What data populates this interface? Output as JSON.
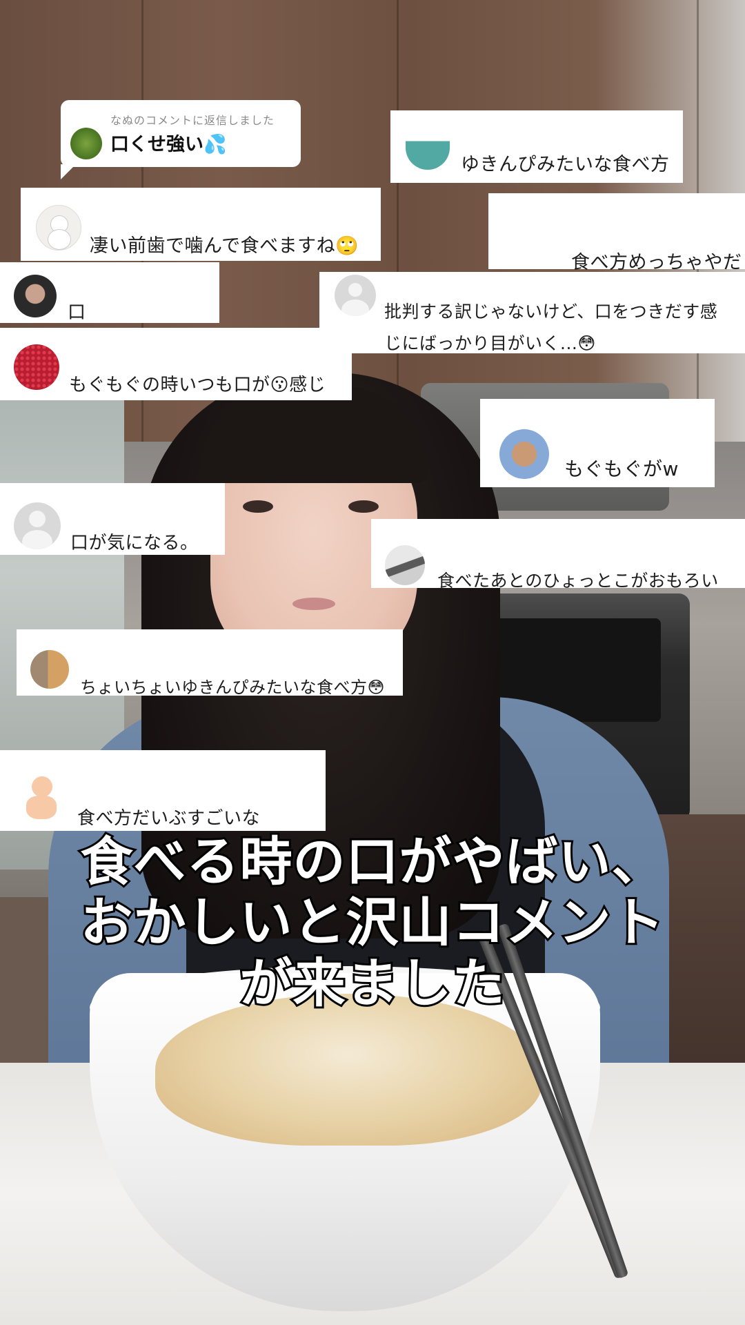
{
  "reply_header": {
    "label": "なぬのコメントに返信しました",
    "text": "口くせ強い💦"
  },
  "comments": [
    {
      "text": "ゆきんぴみたいな食べ方"
    },
    {
      "text": "凄い前歯で噛んで食べますね🙄"
    },
    {
      "text": "食べ方めっちゃやだ"
    },
    {
      "text": "口"
    },
    {
      "text": "批判する訳じゃないけど、口をつきだす感"
    },
    {
      "text": "じにばっかり目がいく...😳"
    },
    {
      "text": "もぐもぐの時いつも口が😗感じ"
    },
    {
      "text": "もぐもぐがw"
    },
    {
      "text": "口が気になる。"
    },
    {
      "text": "食べたあとのひょっとこがおもろい"
    },
    {
      "text": "ちょいちょいゆきんぴみたいな食べ方😳"
    },
    {
      "text": "食べ方だいぶすごいな"
    }
  ],
  "caption": {
    "line1": "食べる時の口がやばい、",
    "line2": "おかしいと沢山コメント",
    "line3": "が来ました"
  },
  "avatar_icons": [
    "moss-avatar-icon",
    "teal-avatar-icon",
    "snowman-avatar-icon",
    "person-photo-avatar-icon",
    "default-user-avatar-icon",
    "red-pattern-avatar-icon",
    "face-photo-avatar-icon",
    "default-user-avatar-icon",
    "car-avatar-icon",
    "cartoon-avatar-icon",
    "baby-avatar-icon"
  ]
}
